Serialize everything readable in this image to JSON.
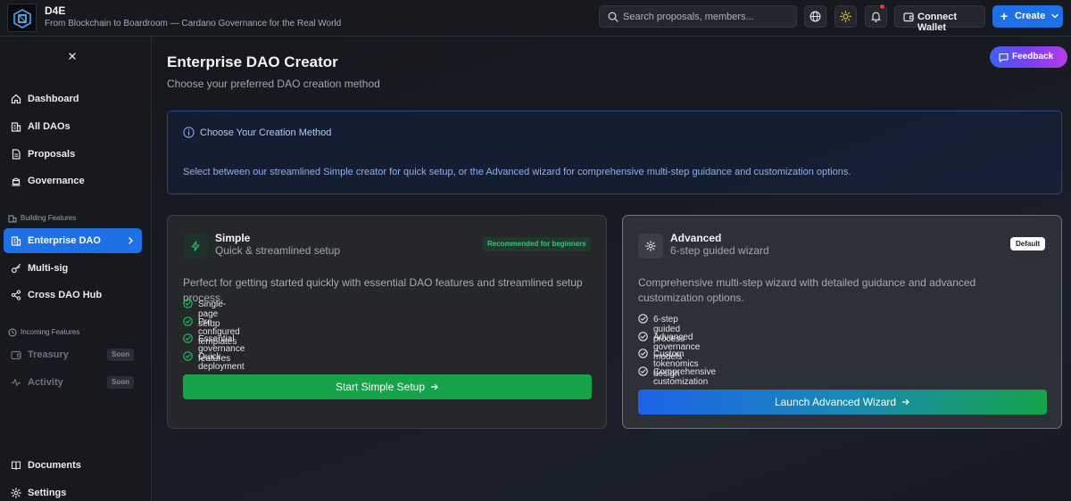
{
  "app": {
    "name": "D4E",
    "tagline": "From Blockchain to Boardroom — Cardano Governance for the Real World"
  },
  "header": {
    "search_placeholder": "Search proposals, members...",
    "connect_wallet_label": "Connect Wallet",
    "create_label": "Create",
    "icons": [
      "search-icon",
      "globe-icon",
      "sun-icon",
      "bell-icon",
      "wallet-icon",
      "plus-icon",
      "chevron-down-icon"
    ]
  },
  "sidebar": {
    "items": [
      {
        "label": "Dashboard",
        "icon": "home-icon"
      },
      {
        "label": "All DAOs",
        "icon": "building-icon"
      },
      {
        "label": "Proposals",
        "icon": "document-icon"
      },
      {
        "label": "Governance",
        "icon": "scale-icon"
      }
    ],
    "building_section_label": "Building Features",
    "building_items": [
      {
        "label": "Enterprise DAO",
        "icon": "building-icon",
        "active": true
      },
      {
        "label": "Multi-sig",
        "icon": "key-icon"
      },
      {
        "label": "Cross DAO Hub",
        "icon": "share-icon"
      }
    ],
    "incoming_section_label": "Incoming Features",
    "incoming_items": [
      {
        "label": "Treasury",
        "badge": "Soon"
      },
      {
        "label": "Activity",
        "badge": "Soon"
      }
    ],
    "bottom_items": [
      {
        "label": "Documents",
        "icon": "book-icon"
      },
      {
        "label": "Settings",
        "icon": "gear-icon"
      }
    ]
  },
  "main": {
    "title": "Enterprise DAO Creator",
    "subtitle": "Choose your preferred DAO creation method",
    "feedback_label": "Feedback",
    "info": {
      "title": "Choose Your Creation Method",
      "description": "Select between our streamlined Simple creator for quick setup, or the Advanced wizard for comprehensive multi-step guidance and customization options."
    },
    "simple": {
      "title": "Simple",
      "subtitle": "Quick & streamlined setup",
      "badge": "Recommended for beginners",
      "description": "Perfect for getting started quickly with essential DAO features and streamlined setup process.",
      "features": [
        "Single-page setup",
        "Pre-configured templates",
        "Essential governance features",
        "Quick deployment"
      ],
      "cta": "Start Simple Setup"
    },
    "advanced": {
      "title": "Advanced",
      "subtitle": "6-step guided wizard",
      "badge": "Default",
      "description": "Comprehensive multi-step wizard with detailed guidance and advanced customization options.",
      "features": [
        "6-step guided process",
        "Advanced governance models",
        "Custom tokenomics design",
        "Comprehensive customization"
      ],
      "cta": "Launch Advanced Wizard"
    }
  },
  "colors": {
    "accent_blue": "#1f6fe5",
    "success_green": "#16a34a",
    "background": "#16181d"
  }
}
